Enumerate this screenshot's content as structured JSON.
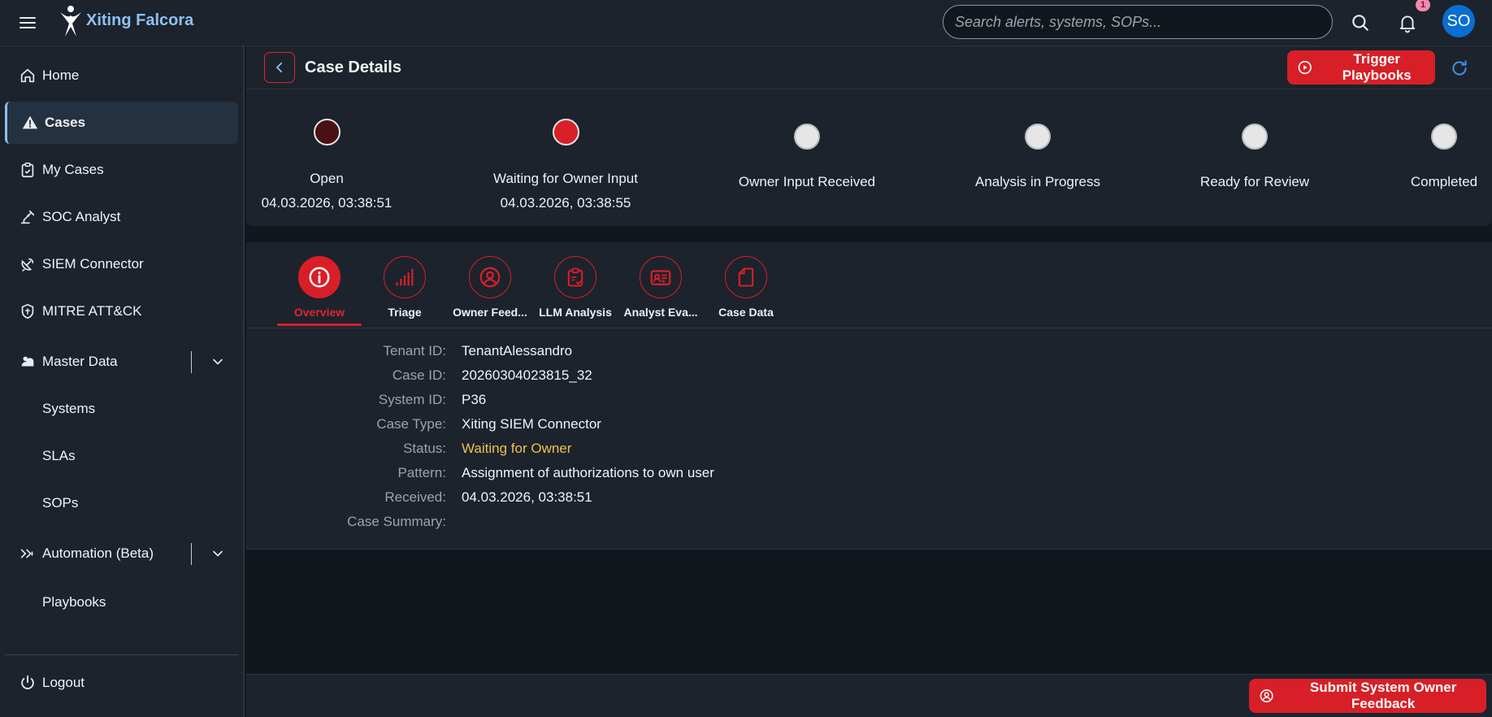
{
  "topbar": {
    "brand": "Xiting Falcora",
    "search_placeholder": "Search alerts, systems, SOPs...",
    "notification_count": "1",
    "avatar_initials": "SO"
  },
  "sidebar": {
    "items": [
      {
        "label": "Home",
        "icon": "home-icon"
      },
      {
        "label": "Cases",
        "icon": "warning-icon",
        "active": true
      },
      {
        "label": "My Cases",
        "icon": "clipboard-icon"
      },
      {
        "label": "SOC Analyst",
        "icon": "robot-arm-icon"
      },
      {
        "label": "SIEM Connector",
        "icon": "satellite-dish-icon"
      },
      {
        "label": "MITRE ATT&CK",
        "icon": "shield-icon"
      },
      {
        "label": "Master Data",
        "icon": "database-icon",
        "expandable": true
      },
      {
        "label": "Systems"
      },
      {
        "label": "SLAs"
      },
      {
        "label": "SOPs"
      },
      {
        "label": "Automation (Beta)",
        "icon": "double-chevron-right-icon",
        "expandable": true
      },
      {
        "label": "Playbooks"
      }
    ],
    "logout_label": "Logout"
  },
  "header": {
    "title": "Case Details",
    "trigger_label": "Trigger Playbooks"
  },
  "progress": {
    "steps": [
      {
        "label": "Open",
        "timestamp": "04.03.2026, 03:38:51",
        "state": "done"
      },
      {
        "label": "Waiting for Owner Input",
        "timestamp": "04.03.2026, 03:38:55",
        "state": "current"
      },
      {
        "label": "Owner Input Received",
        "state": "pending"
      },
      {
        "label": "Analysis in Progress",
        "state": "pending"
      },
      {
        "label": "Ready for Review",
        "state": "pending"
      },
      {
        "label": "Completed",
        "state": "pending"
      }
    ],
    "colors": {
      "done": "#4a1115",
      "current": "#d81f27",
      "pending": "#e6e6e6"
    }
  },
  "tabs": [
    {
      "label": "Overview",
      "icon": "info-icon",
      "active": true
    },
    {
      "label": "Triage",
      "icon": "signal-bars-icon"
    },
    {
      "label": "Owner Feed...",
      "icon": "user-circle-icon"
    },
    {
      "label": "LLM Analysis",
      "icon": "clipboard-check-icon"
    },
    {
      "label": "Analyst Eva...",
      "icon": "id-card-icon"
    },
    {
      "label": "Case Data",
      "icon": "document-icon"
    }
  ],
  "details": {
    "rows": [
      {
        "label": "Tenant ID:",
        "value": "TenantAlessandro"
      },
      {
        "label": "Case ID:",
        "value": "20260304023815_32"
      },
      {
        "label": "System ID:",
        "value": "P36"
      },
      {
        "label": "Case Type:",
        "value": "Xiting SIEM Connector"
      },
      {
        "label": "Status:",
        "value": "Waiting for Owner"
      },
      {
        "label": "Pattern:",
        "value": "Assignment of authorizations to own user"
      },
      {
        "label": "Received:",
        "value": "04.03.2026, 03:38:51"
      },
      {
        "label": "Case Summary:",
        "value": ""
      }
    ],
    "status_color": "#f0c14a"
  },
  "footer": {
    "submit_label": "Submit System Owner Feedback"
  },
  "colors": {
    "accent_red": "#d81f27",
    "brand_blue": "#8fc1f0",
    "panel": "#1c232c",
    "background": "#12171d"
  }
}
